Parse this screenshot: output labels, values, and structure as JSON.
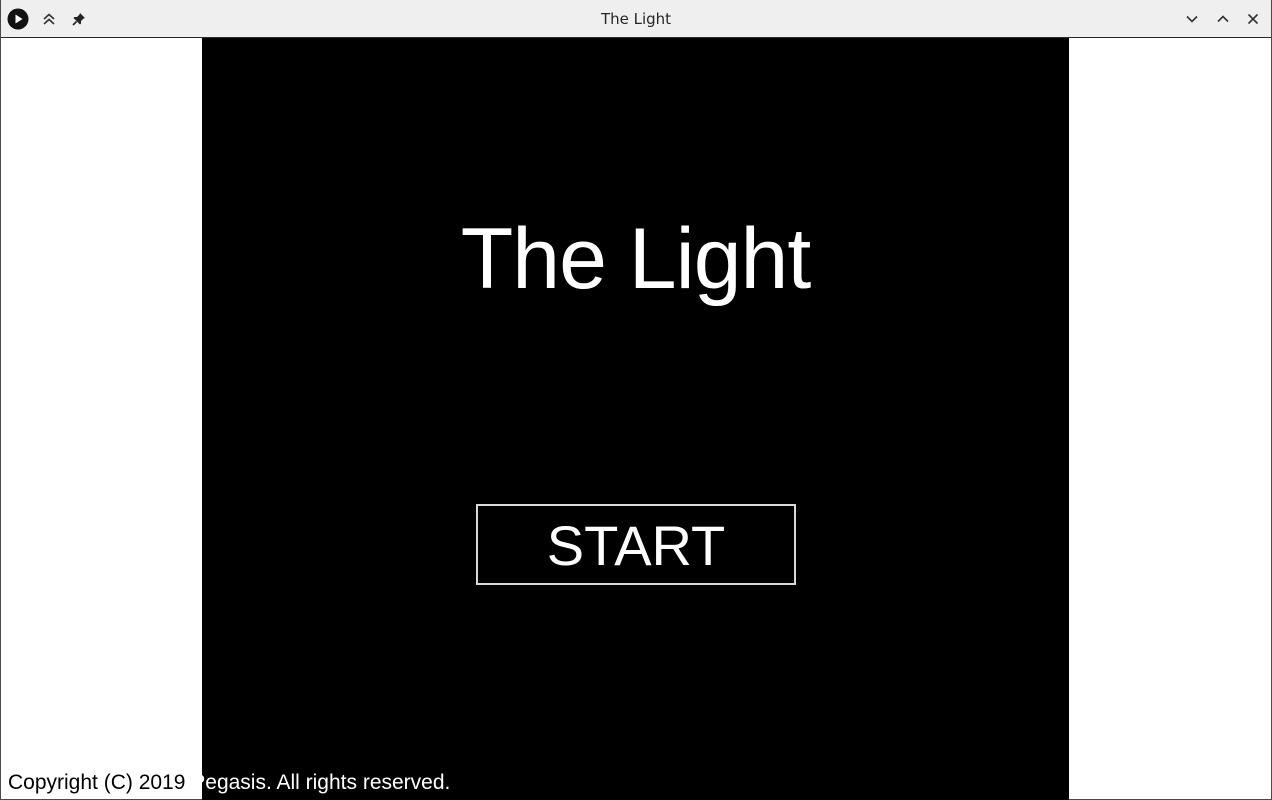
{
  "window": {
    "title": "The Light",
    "titlebar_bg": "#efefef",
    "buttons": {
      "app_menu_icon": "play-circle-icon",
      "keep_above_icon": "double-chevron-up-icon",
      "pin_icon": "pin-icon",
      "minimize_icon": "chevron-down-icon",
      "maximize_icon": "chevron-up-icon",
      "close_icon": "close-icon"
    }
  },
  "game": {
    "background": "#000000",
    "title": "The Light",
    "start_label": "START"
  },
  "footer": {
    "copyright_part1": "Copyright (C) 2019",
    "copyright_part2": " Pegasis. All rights reserved."
  }
}
